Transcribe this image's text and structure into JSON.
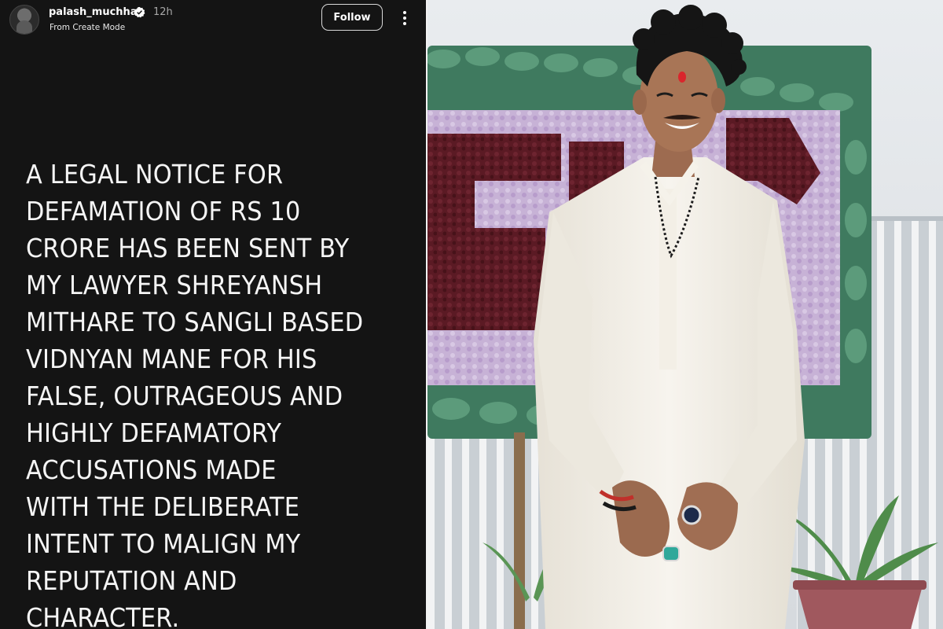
{
  "post": {
    "username": "palash_muchhal",
    "time_ago": "12h",
    "subtitle": "From Create Mode",
    "follow_label": "Follow",
    "verified": true,
    "icons": {
      "avatar": "profile-avatar",
      "verified": "verified-badge-icon",
      "more": "more-options-icon"
    }
  },
  "notice_lines": [
    "A LEGAL NOTICE FOR",
    "DEFAMATION OF RS 10",
    "CRORE HAS BEEN SENT BY",
    "MY LAWYER SHREYANSH",
    "MITHARE TO SANGLI BASED",
    "VIDNYAN MANE FOR HIS",
    "FALSE, OUTRAGEOUS AND",
    "HIGHLY DEFAMATORY",
    "ACCUSATIONS MADE",
    "WITH THE DELIBERATE",
    "INTENT TO MALIGN MY",
    "REPUTATION AND",
    "CHARACTER."
  ],
  "colors": {
    "background": "#141414",
    "text": "#f5f5f5",
    "muted": "#a8a8a8",
    "kurta": "#f4f1ea",
    "flowers": "#c9b3d8",
    "maroon": "#5a1a22",
    "leaves": "#3e7a5e"
  }
}
